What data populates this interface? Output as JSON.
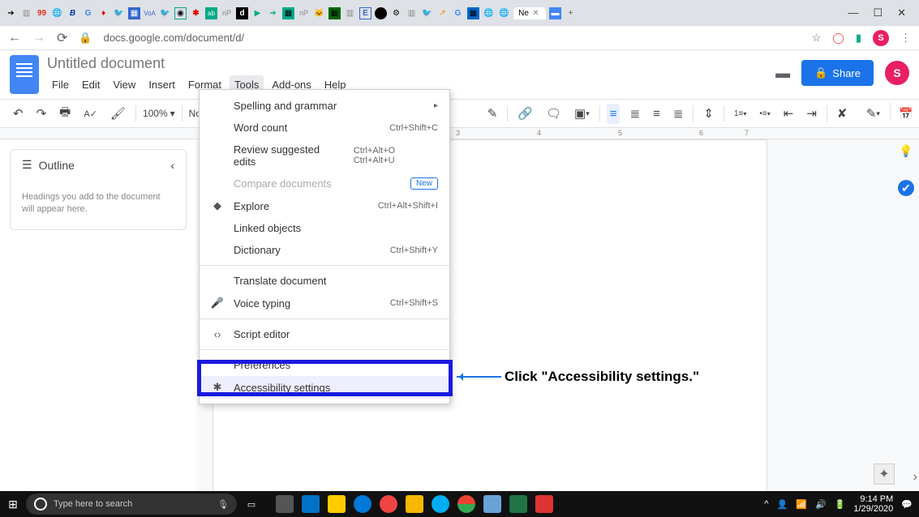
{
  "browser": {
    "url": "docs.google.com/document/d/",
    "win_min": "—",
    "win_max": "☐",
    "win_close": "✕",
    "star": "☆",
    "menu": "⋮",
    "avatar_letter": "S",
    "back": "←",
    "forward": "→",
    "reload": "⟳",
    "lock": "🔒",
    "plus": "+",
    "close_tab": "✕",
    "active_tab": "Ne"
  },
  "docs": {
    "title": "Untitled document",
    "menu": {
      "file": "File",
      "edit": "Edit",
      "view": "View",
      "insert": "Insert",
      "format": "Format",
      "tools": "Tools",
      "addons": "Add-ons",
      "help": "Help"
    },
    "share": "Share",
    "comment_icon": "▬"
  },
  "toolbar": {
    "undo": "↶",
    "redo": "↷",
    "print": "🖶",
    "spell": "A✓",
    "paint": "🖌",
    "zoom": "100%",
    "dropdown_arrow": "▾",
    "style": "Norma",
    "link": "🔗",
    "comment": "🗨",
    "image": "▣",
    "align_left": "≡",
    "align_center": "≣",
    "align_right": "≡",
    "align_justify": "≣",
    "spacing": "⇕",
    "list_num": "1≡",
    "list_bul": "•≡",
    "indent_dec": "⇤",
    "indent_inc": "⇥",
    "clear": "✘",
    "pencil": "✎",
    "collapse": "^"
  },
  "ruler": {
    "n3": "3",
    "n4": "4",
    "n5": "5",
    "n6": "6",
    "n7": "7"
  },
  "outline": {
    "icon": "☰",
    "title": "Outline",
    "collapse": "‹",
    "hint": "Headings you add to the document will appear here."
  },
  "dropdown": {
    "spelling": "Spelling and grammar",
    "word_count": "Word count",
    "word_count_sc": "Ctrl+Shift+C",
    "review": "Review suggested edits",
    "review_sc": "Ctrl+Alt+O Ctrl+Alt+U",
    "compare": "Compare documents",
    "new_badge": "New",
    "explore": "Explore",
    "explore_sc": "Ctrl+Alt+Shift+I",
    "linked": "Linked objects",
    "dictionary": "Dictionary",
    "dictionary_sc": "Ctrl+Shift+Y",
    "translate": "Translate document",
    "voice": "Voice typing",
    "voice_sc": "Ctrl+Shift+S",
    "script": "Script editor",
    "preferences": "Preferences",
    "accessibility": "Accessibility settings",
    "arrow": "▸",
    "explore_icon": "◆",
    "voice_icon": "🎤",
    "script_icon": "‹›",
    "access_icon": "✱"
  },
  "callout": {
    "text": "Click \"Accessibility settings.\""
  },
  "side": {
    "calendar_bg": "#4285f4",
    "keep_bg": "#fbbc04",
    "tasks_bg": "#1a73e8"
  },
  "taskbar": {
    "start": "⊞",
    "search_placeholder": "Type here to search",
    "mic": "🎙",
    "time": "9:14 PM",
    "date": "1/29/2020",
    "tray_up": "^",
    "tray_person": "👤",
    "tray_wifi": "📶",
    "tray_vol": "🔊",
    "tray_bat": "🔋",
    "tray_msg": "💬"
  }
}
